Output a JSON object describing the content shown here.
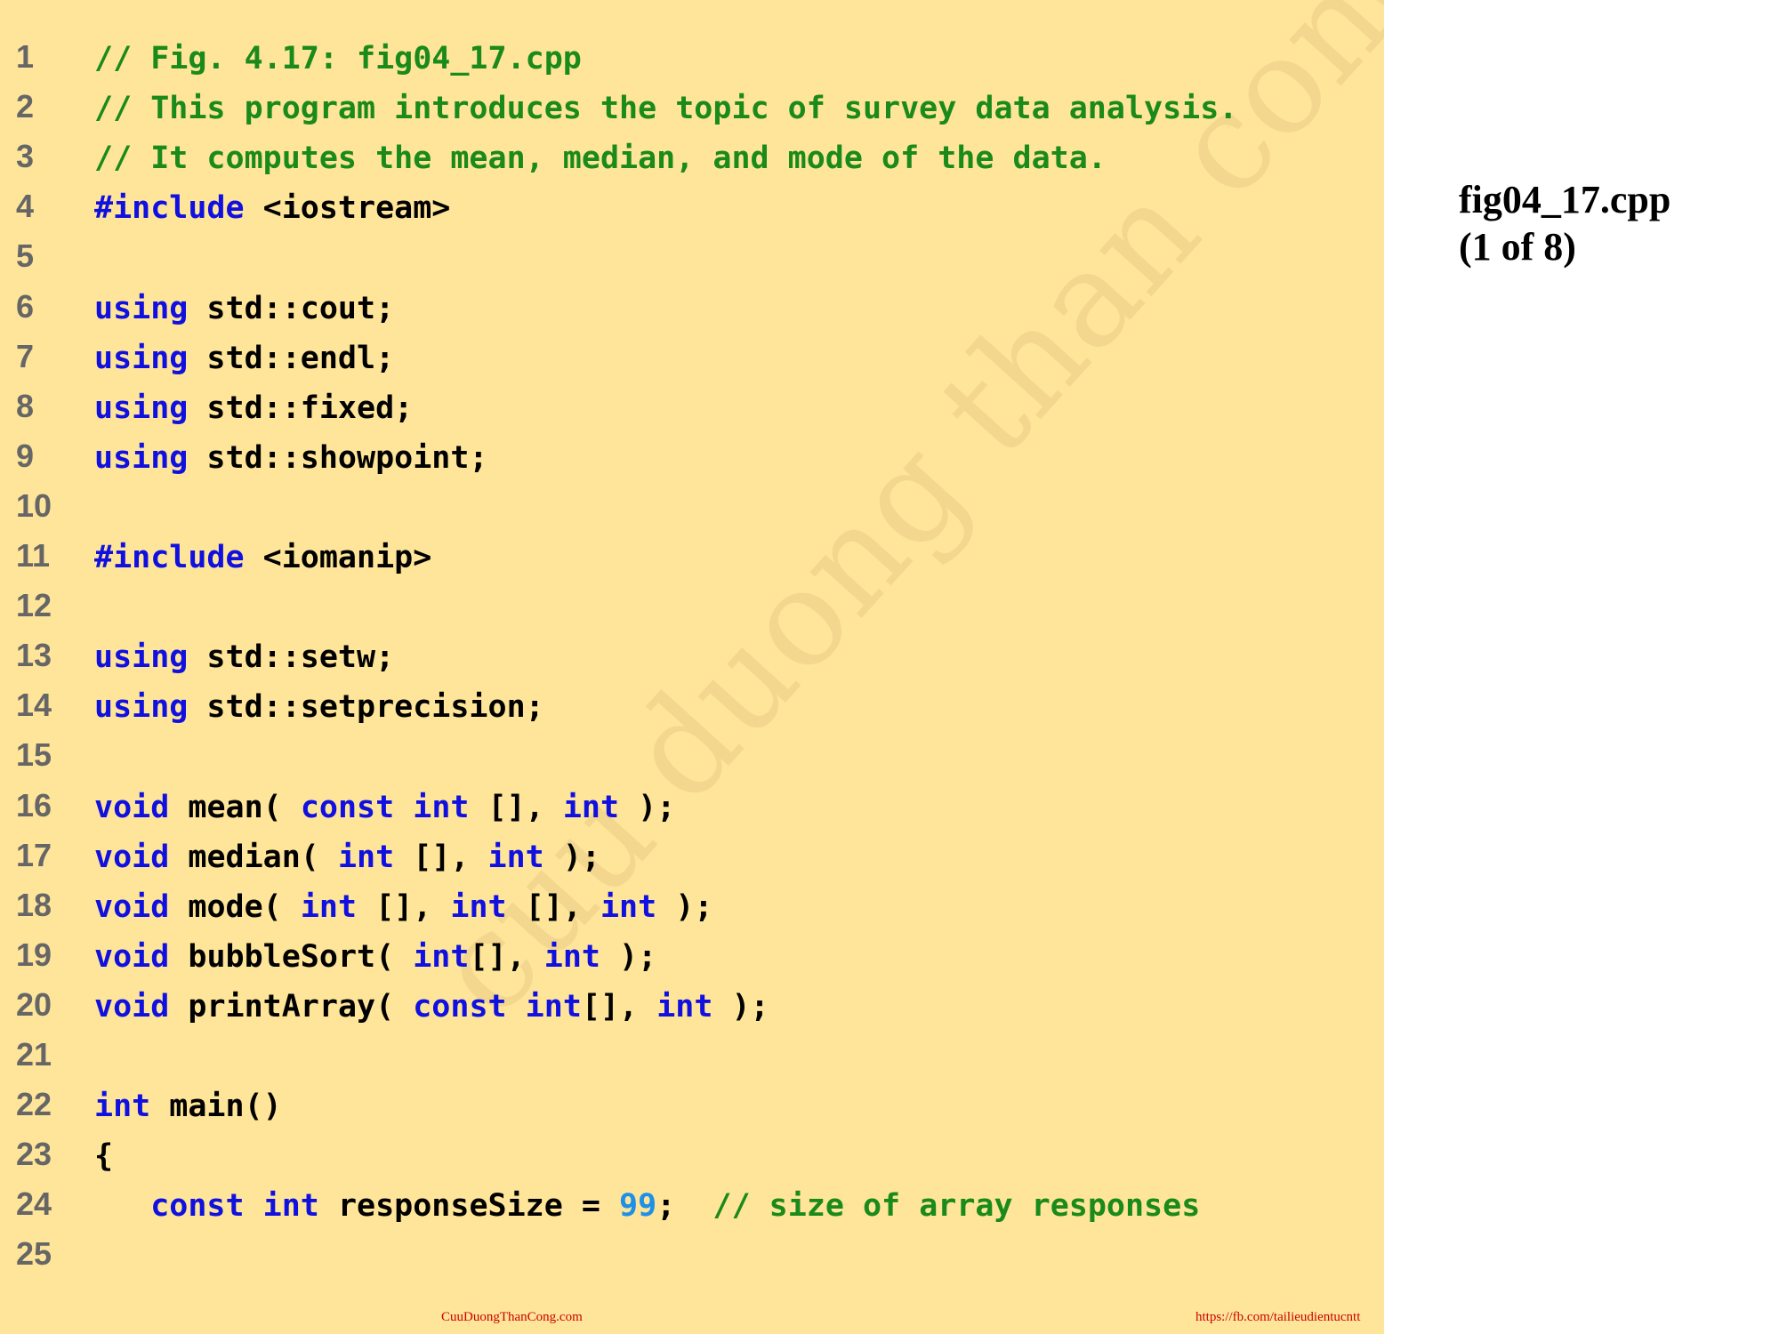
{
  "side_label": {
    "file": "fig04_17.cpp",
    "page": "(1 of 8)"
  },
  "watermark": "cuu duong than cong . com",
  "footer": {
    "left": "CuuDuongThanCong.com",
    "right": "https://fb.com/tailieudientucntt"
  },
  "colors": {
    "panel": "#ffe599",
    "comment": "#1a8a1a",
    "keyword": "#1010e0",
    "number": "#1e90e8",
    "line_number": "#666666"
  },
  "lines": [
    {
      "n": "1",
      "tokens": [
        {
          "t": "// Fig. 4.17: fig04_17.cpp",
          "c": "comment"
        }
      ]
    },
    {
      "n": "2",
      "tokens": [
        {
          "t": "// This program introduces the topic of survey data analysis.",
          "c": "comment"
        }
      ]
    },
    {
      "n": "3",
      "tokens": [
        {
          "t": "// It computes the mean, median, and mode of the data.",
          "c": "comment"
        }
      ]
    },
    {
      "n": "4",
      "tokens": [
        {
          "t": "#include",
          "c": "kw"
        },
        {
          "t": " <iostream>",
          "c": "plain"
        }
      ]
    },
    {
      "n": "5",
      "tokens": []
    },
    {
      "n": "6",
      "tokens": [
        {
          "t": "using",
          "c": "kw"
        },
        {
          "t": " std::cout;",
          "c": "plain"
        }
      ]
    },
    {
      "n": "7",
      "tokens": [
        {
          "t": "using",
          "c": "kw"
        },
        {
          "t": " std::endl;",
          "c": "plain"
        }
      ]
    },
    {
      "n": "8",
      "tokens": [
        {
          "t": "using",
          "c": "kw"
        },
        {
          "t": " std::fixed;",
          "c": "plain"
        }
      ]
    },
    {
      "n": "9",
      "tokens": [
        {
          "t": "using",
          "c": "kw"
        },
        {
          "t": " std::showpoint;",
          "c": "plain"
        }
      ]
    },
    {
      "n": "10",
      "tokens": []
    },
    {
      "n": "11",
      "tokens": [
        {
          "t": "#include",
          "c": "kw"
        },
        {
          "t": " <iomanip>",
          "c": "plain"
        }
      ]
    },
    {
      "n": "12",
      "tokens": []
    },
    {
      "n": "13",
      "tokens": [
        {
          "t": "using",
          "c": "kw"
        },
        {
          "t": " std::setw;",
          "c": "plain"
        }
      ]
    },
    {
      "n": "14",
      "tokens": [
        {
          "t": "using",
          "c": "kw"
        },
        {
          "t": " std::setprecision;",
          "c": "plain"
        }
      ]
    },
    {
      "n": "15",
      "tokens": []
    },
    {
      "n": "16",
      "tokens": [
        {
          "t": "void",
          "c": "kw"
        },
        {
          "t": " mean( ",
          "c": "plain"
        },
        {
          "t": "const",
          "c": "kw"
        },
        {
          "t": " ",
          "c": "plain"
        },
        {
          "t": "int",
          "c": "kw"
        },
        {
          "t": " [], ",
          "c": "plain"
        },
        {
          "t": "int",
          "c": "kw"
        },
        {
          "t": " );",
          "c": "plain"
        }
      ]
    },
    {
      "n": "17",
      "tokens": [
        {
          "t": "void",
          "c": "kw"
        },
        {
          "t": " median( ",
          "c": "plain"
        },
        {
          "t": "int",
          "c": "kw"
        },
        {
          "t": " [], ",
          "c": "plain"
        },
        {
          "t": "int",
          "c": "kw"
        },
        {
          "t": " );",
          "c": "plain"
        }
      ]
    },
    {
      "n": "18",
      "tokens": [
        {
          "t": "void",
          "c": "kw"
        },
        {
          "t": " mode( ",
          "c": "plain"
        },
        {
          "t": "int",
          "c": "kw"
        },
        {
          "t": " [], ",
          "c": "plain"
        },
        {
          "t": "int",
          "c": "kw"
        },
        {
          "t": " [], ",
          "c": "plain"
        },
        {
          "t": "int",
          "c": "kw"
        },
        {
          "t": " );",
          "c": "plain"
        }
      ]
    },
    {
      "n": "19",
      "tokens": [
        {
          "t": "void",
          "c": "kw"
        },
        {
          "t": " bubbleSort( ",
          "c": "plain"
        },
        {
          "t": "int",
          "c": "kw"
        },
        {
          "t": "[], ",
          "c": "plain"
        },
        {
          "t": "int",
          "c": "kw"
        },
        {
          "t": " );",
          "c": "plain"
        }
      ]
    },
    {
      "n": "20",
      "tokens": [
        {
          "t": "void",
          "c": "kw"
        },
        {
          "t": " printArray( ",
          "c": "plain"
        },
        {
          "t": "const",
          "c": "kw"
        },
        {
          "t": " ",
          "c": "plain"
        },
        {
          "t": "int",
          "c": "kw"
        },
        {
          "t": "[], ",
          "c": "plain"
        },
        {
          "t": "int",
          "c": "kw"
        },
        {
          "t": " );",
          "c": "plain"
        }
      ]
    },
    {
      "n": "21",
      "tokens": []
    },
    {
      "n": "22",
      "tokens": [
        {
          "t": "int",
          "c": "kw"
        },
        {
          "t": " main()",
          "c": "plain"
        }
      ]
    },
    {
      "n": "23",
      "tokens": [
        {
          "t": "{",
          "c": "plain"
        }
      ]
    },
    {
      "n": "24",
      "tokens": [
        {
          "t": "   ",
          "c": "plain"
        },
        {
          "t": "const",
          "c": "kw"
        },
        {
          "t": " ",
          "c": "plain"
        },
        {
          "t": "int",
          "c": "kw"
        },
        {
          "t": " responseSize = ",
          "c": "plain"
        },
        {
          "t": "99",
          "c": "num"
        },
        {
          "t": ";  ",
          "c": "plain"
        },
        {
          "t": "// size of array responses",
          "c": "comment"
        }
      ]
    },
    {
      "n": "25",
      "tokens": []
    }
  ]
}
